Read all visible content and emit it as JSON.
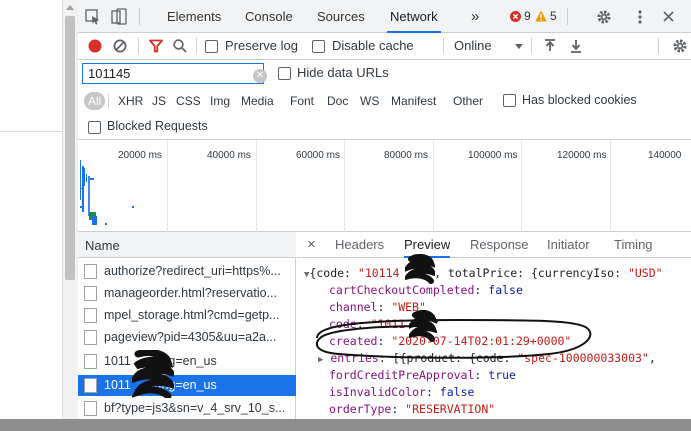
{
  "tabs": {
    "elements": "Elements",
    "console": "Console",
    "sources": "Sources",
    "network": "Network",
    "more": "»",
    "errors": "9",
    "warnings": "5"
  },
  "toolbar": {
    "preserve_log": "Preserve log",
    "disable_cache": "Disable cache",
    "throttle": "Online"
  },
  "filter": {
    "value": "101145",
    "hide_data_urls": "Hide data URLs"
  },
  "types": [
    "All",
    "XHR",
    "JS",
    "CSS",
    "Img",
    "Media",
    "Font",
    "Doc",
    "WS",
    "Manifest",
    "Other"
  ],
  "has_blocked_cookies": "Has blocked cookies",
  "blocked_requests": "Blocked Requests",
  "timeline": {
    "ticks": [
      "20000 ms",
      "40000 ms",
      "60000 ms",
      "80000 ms",
      "100000 ms",
      "120000 ms",
      "140000"
    ]
  },
  "requests": {
    "header": "Name",
    "rows": [
      "authorize?redirect_uri=https%...",
      "manageorder.html?reservatio...",
      "mpel_storage.html?cmd=getp...",
      "pageview?pid=4305&uu=a2a...",
      "1011      lang=en_us",
      "1011      lang=en_us",
      "bf?type=js3&sn=v_4_srv_10_s..."
    ],
    "selected_index": 5
  },
  "detail": {
    "close": "×",
    "tabs": [
      "Headers",
      "Preview",
      "Response",
      "Initiator",
      "Timing"
    ],
    "active_tab": "Preview",
    "lines": {
      "l1_open": "{code: ",
      "l1_code": "\"10114    \"",
      "l1_mid": ", totalPrice: {currencyIso: ",
      "l1_iso": "\"USD\"",
      "l2_key": "cartCheckoutCompleted",
      "l2_val": "false",
      "l3_key": "channel",
      "l3_val": "\"WEB\"",
      "l4_key": "code",
      "l4_val": "\"1011    \"",
      "l5_key": "created",
      "l5_val": "\"2020-07-14T02:01:29+0000\"",
      "l6_key": "entries",
      "l6_val": "[{product: {code: ",
      "l6_code": "\"spec-100000033003\"",
      "l6_tail": ",",
      "l7_key": "fordCreditPreApproval",
      "l7_val": "true",
      "l8_key": "isInvalidColor",
      "l8_val": "false",
      "l9_key": "orderType",
      "l9_val": "\"RESERVATION\""
    }
  },
  "colors": {
    "accent": "#1a73e8",
    "error": "#d93025",
    "warning": "#f29900",
    "record": "#d93025",
    "string": "#c41a16",
    "key": "#881280",
    "bool": "#0d22aa"
  }
}
